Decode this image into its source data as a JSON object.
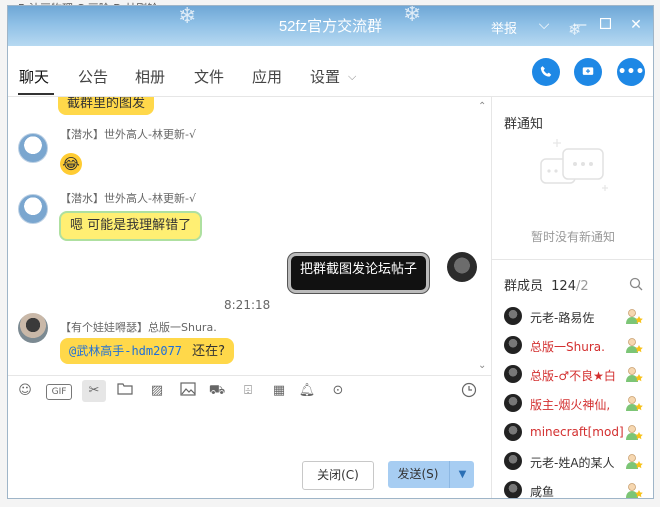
{
  "background": {
    "text": "B 油画物理 C 画险 D 林刚铃"
  },
  "window": {
    "title": "52fz官方交流群",
    "report_label": "举报",
    "colors": {
      "title_gradient_top": "#6fa7d6",
      "accent": "#1e88e5",
      "own_bubble": "#ffd84a",
      "send_button": "#a7cdf2"
    }
  },
  "tabs": [
    {
      "label": "聊天",
      "active": true
    },
    {
      "label": "公告"
    },
    {
      "label": "相册"
    },
    {
      "label": "文件"
    },
    {
      "label": "应用"
    },
    {
      "label": "设置"
    }
  ],
  "header_actions": [
    "phone-icon",
    "screen-share-icon",
    "more-icon"
  ],
  "chat": {
    "partial_bubble": "截群里的图发",
    "messages": [
      {
        "nick": "【潜水】世外高人-林更新-√",
        "content": "😂",
        "kind": "emoji"
      },
      {
        "nick": "【潜水】世外高人-林更新-√",
        "content": "嗯  可能是我理解错了",
        "kind": "bubble"
      },
      {
        "content": "把群截图发论坛帖子",
        "kind": "self"
      },
      {
        "timestamp": "8:21:18"
      },
      {
        "nick": "【有个娃娃嘚瑟】总版一Shura.",
        "mention": "@武林高手-hdm2077",
        "content": "还在?"
      }
    ]
  },
  "toolbar_icons": [
    "emoji-icon",
    "gif-icon",
    "scissors-icon",
    "folder-icon",
    "image-text-icon",
    "picture-icon",
    "gamepad-icon",
    "gift-icon",
    "calendar-icon",
    "bell-icon",
    "more-icon",
    "history-icon"
  ],
  "buttons": {
    "close": "关闭(C)",
    "send": "发送(S)"
  },
  "right_panel": {
    "notice_title": "群通知",
    "notice_empty": "暂时没有新通知",
    "members_title": "群成员",
    "member_count": "124",
    "member_total": "/2",
    "members": [
      {
        "name": "元老-路易佐",
        "color": "#333333"
      },
      {
        "name": "总版一Shura.",
        "color": "#d32f2f"
      },
      {
        "name": "总版-♂不良★白",
        "color": "#d32f2f"
      },
      {
        "name": "版主-烟火神仙,",
        "color": "#d32f2f"
      },
      {
        "name": "minecraft[mod]",
        "color": "#d32f2f"
      },
      {
        "name": "元老-姓A的某人",
        "color": "#333333"
      },
      {
        "name": "咸鱼",
        "color": "#333333"
      }
    ]
  }
}
